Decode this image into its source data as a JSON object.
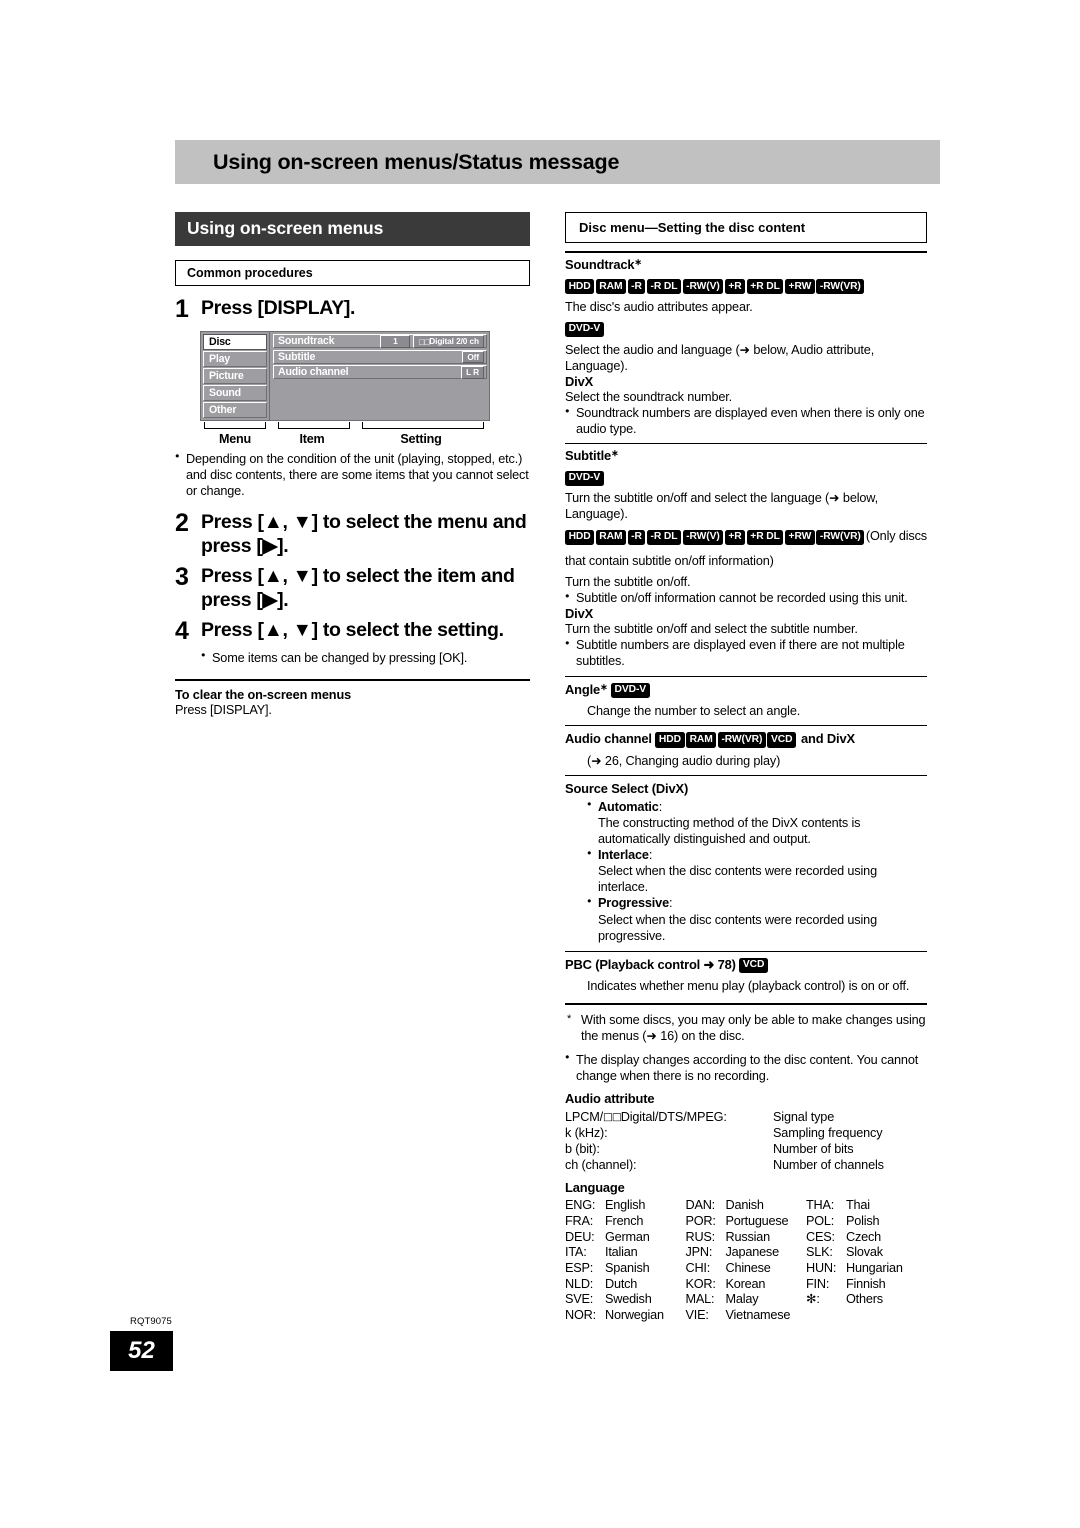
{
  "chapter": {
    "title": "Using on-screen menus/Status message"
  },
  "left": {
    "section_header": "Using on-screen menus",
    "common_box": "Common procedures",
    "steps": [
      {
        "num": "1",
        "text": "Press [DISPLAY]."
      },
      {
        "num": "2",
        "text": "Press [▲, ▼] to select the menu and press [▶]."
      },
      {
        "num": "3",
        "text": "Press [▲, ▼] to select the item and press [▶]."
      },
      {
        "num": "4",
        "text": "Press [▲, ▼] to select the setting."
      }
    ],
    "note_after_diagram": "Depending on the condition of the unit (playing, stopped, etc.) and disc contents, there are some items that you cannot select or change.",
    "note_after_step4": "Some items can be changed by pressing [OK].",
    "clear_title": "To clear the on-screen menus",
    "clear_body": "Press [DISPLAY]."
  },
  "osd": {
    "menu_items": [
      {
        "label": "Disc",
        "selected": true
      },
      {
        "label": "Play",
        "selected": false
      },
      {
        "label": "Picture",
        "selected": false
      },
      {
        "label": "Sound",
        "selected": false
      },
      {
        "label": "Other",
        "selected": false
      }
    ],
    "rows": [
      {
        "item": "Soundtrack",
        "value1": "1",
        "value2": "Digital  2/0 ch",
        "value2_prefix_dd": true
      },
      {
        "item": "Subtitle",
        "value1": "",
        "value2": "Off",
        "value2_prefix_dd": false
      },
      {
        "item": "Audio channel",
        "value1": "",
        "value2": "L R",
        "value2_prefix_dd": false
      }
    ],
    "captions": {
      "menu": "Menu",
      "item": "Item",
      "setting": "Setting"
    }
  },
  "right": {
    "disc_menu_box": "Disc menu—Setting the disc content",
    "soundtrack": {
      "title": "Soundtrack",
      "badges_group1": [
        "HDD",
        "RAM",
        "-R",
        "-R DL",
        "-RW(V)",
        "+R",
        "+R DL",
        "+RW",
        "-RW(VR)"
      ],
      "line1": "The disc's audio attributes appear.",
      "badge_dvdv": "DVD-V",
      "line2": "Select the audio and language (➜ below, Audio attribute, Language).",
      "divx_label": "DivX",
      "line3": "Select the soundtrack number.",
      "bullet1": "Soundtrack numbers are displayed even when there is only one audio type."
    },
    "subtitle": {
      "title": "Subtitle",
      "badge_dvdv": "DVD-V",
      "line1": "Turn the subtitle on/off and select the language (➜ below, Language).",
      "badges_group1": [
        "HDD",
        "RAM",
        "-R",
        "-R DL",
        "-RW(V)",
        "+R",
        "+R DL",
        "+RW",
        "-RW(VR)"
      ],
      "paren": "(Only discs that contain subtitle on/off information)",
      "line2": "Turn the subtitle on/off.",
      "bullet1": "Subtitle on/off information cannot be recorded using this unit.",
      "divx_label": "DivX",
      "line3": "Turn the subtitle on/off and select the subtitle number.",
      "bullet2": "Subtitle numbers are displayed even if there are not multiple subtitles."
    },
    "angle": {
      "title": "Angle",
      "badge": "DVD-V",
      "body": "Change the number to select an angle."
    },
    "audio_channel": {
      "title": "Audio channel",
      "badges": [
        "HDD",
        "RAM",
        "-RW(VR)",
        "VCD"
      ],
      "title_tail": "and DivX",
      "body": "(➜ 26, Changing audio during play)"
    },
    "source_select": {
      "title": "Source Select (DivX)",
      "options": [
        {
          "name": "Automatic",
          "desc": "The constructing method of the DivX contents is automatically distinguished and output."
        },
        {
          "name": "Interlace",
          "desc": "Select when the disc contents were recorded using interlace."
        },
        {
          "name": "Progressive",
          "desc": "Select when the disc contents were recorded using progressive."
        }
      ]
    },
    "pbc": {
      "title": "PBC (Playback control ➜ 78)",
      "badge": "VCD",
      "body": "Indicates whether menu play (playback control) is on or off."
    },
    "footnote_star": "With some discs, you may only be able to make changes using the menus (➜ 16) on the disc.",
    "footnote_bullet": "The display changes according to the disc content. You cannot change when there is no recording.",
    "audio_attribute": {
      "title": "Audio attribute",
      "rows": [
        {
          "left": "LPCM/□□Digital/DTS/MPEG:",
          "right": "Signal type",
          "dd": true
        },
        {
          "left": "k (kHz):",
          "right": "Sampling frequency",
          "dd": false
        },
        {
          "left": "b (bit):",
          "right": "Number of bits",
          "dd": false
        },
        {
          "left": "ch (channel):",
          "right": "Number of channels",
          "dd": false
        }
      ]
    },
    "language": {
      "title": "Language",
      "rows": [
        [
          {
            "code": "ENG:",
            "name": "English"
          },
          {
            "code": "DAN:",
            "name": "Danish"
          },
          {
            "code": "THA:",
            "name": "Thai"
          }
        ],
        [
          {
            "code": "FRA:",
            "name": "French"
          },
          {
            "code": "POR:",
            "name": "Portuguese"
          },
          {
            "code": "POL:",
            "name": "Polish"
          }
        ],
        [
          {
            "code": "DEU:",
            "name": "German"
          },
          {
            "code": "RUS:",
            "name": "Russian"
          },
          {
            "code": "CES:",
            "name": "Czech"
          }
        ],
        [
          {
            "code": "ITA:",
            "name": "Italian"
          },
          {
            "code": "JPN:",
            "name": "Japanese"
          },
          {
            "code": "SLK:",
            "name": "Slovak"
          }
        ],
        [
          {
            "code": "ESP:",
            "name": "Spanish"
          },
          {
            "code": "CHI:",
            "name": "Chinese"
          },
          {
            "code": "HUN:",
            "name": "Hungarian"
          }
        ],
        [
          {
            "code": "NLD:",
            "name": "Dutch"
          },
          {
            "code": "KOR:",
            "name": "Korean"
          },
          {
            "code": "FIN:",
            "name": "Finnish"
          }
        ],
        [
          {
            "code": "SVE:",
            "name": "Swedish"
          },
          {
            "code": "MAL:",
            "name": "Malay"
          },
          {
            "code": "✻:",
            "name": "Others"
          }
        ],
        [
          {
            "code": "NOR:",
            "name": "Norwegian"
          },
          {
            "code": "VIE:",
            "name": "Vietnamese"
          },
          {
            "code": "",
            "name": ""
          }
        ]
      ]
    }
  },
  "footer": {
    "code": "RQT9075",
    "page": "52"
  }
}
